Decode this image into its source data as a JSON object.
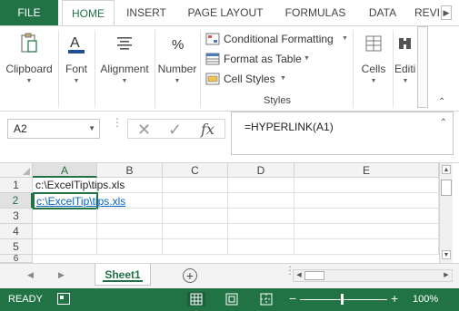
{
  "ribbon_tabs": [
    "FILE",
    "HOME",
    "INSERT",
    "PAGE LAYOUT",
    "FORMULAS",
    "DATA",
    "REVI"
  ],
  "active_tab": "HOME",
  "ribbon": {
    "clipboard": "Clipboard",
    "font": "Font",
    "alignment": "Alignment",
    "number": "Number",
    "conditional_formatting": "Conditional Formatting",
    "format_as_table": "Format as Table",
    "cell_styles": "Cell Styles",
    "styles_group": "Styles",
    "cells": "Cells",
    "editing": "Editi"
  },
  "formula_bar": {
    "name_box": "A2",
    "formula": "=HYPERLINK(A1)",
    "fx_label": "fx"
  },
  "grid": {
    "columns": [
      "A",
      "B",
      "C",
      "D",
      "E"
    ],
    "active_column": "A",
    "rows": [
      "1",
      "2",
      "3",
      "4",
      "5",
      "6"
    ],
    "active_row": "2",
    "cells": {
      "A1": "c:\\ExcelTip\\tips.xls",
      "A2": "c:\\ExcelTip\\tips.xls"
    }
  },
  "sheet_tabs": [
    "Sheet1"
  ],
  "status_bar": {
    "mode": "READY",
    "zoom": "100%",
    "zoom_fraction": 0.5
  },
  "colors": {
    "excel_green": "#217346",
    "hyperlink": "#0563c1"
  }
}
